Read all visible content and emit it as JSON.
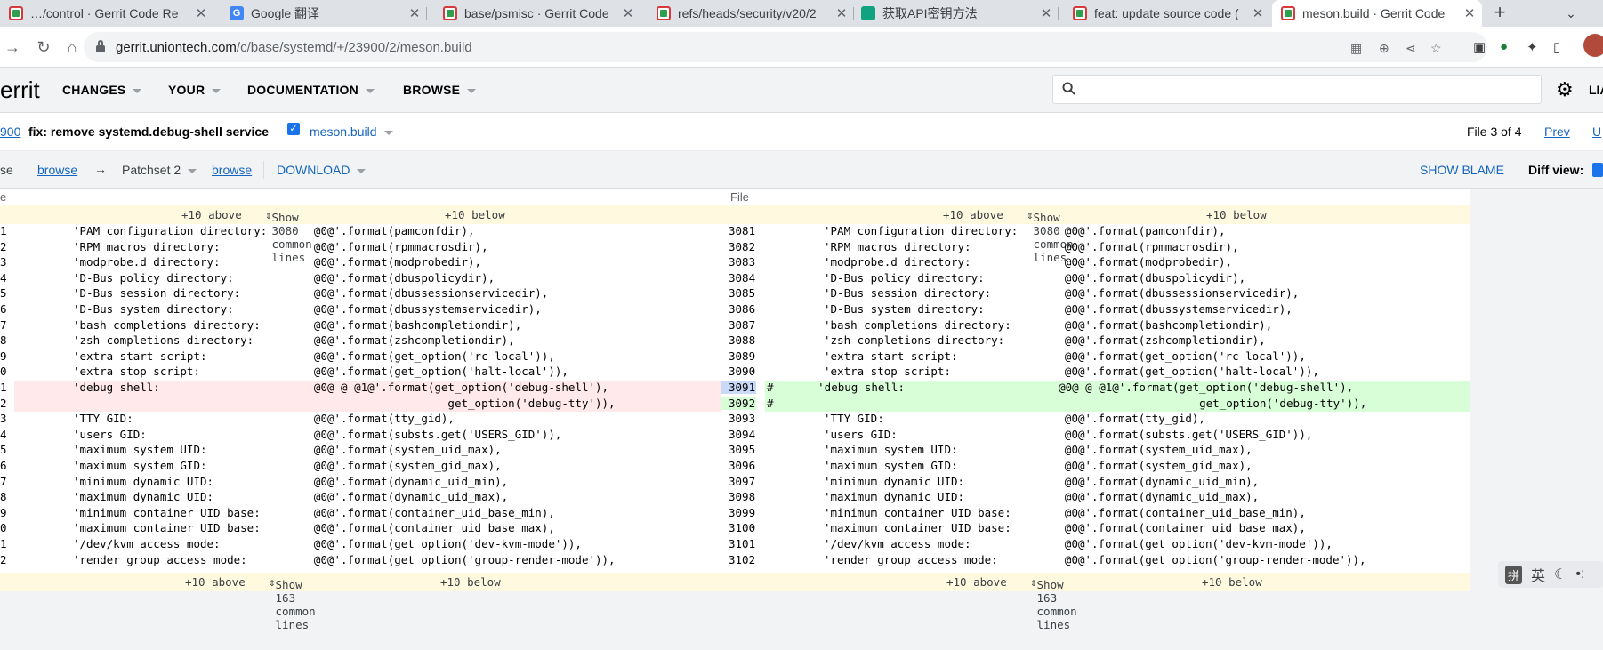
{
  "tabs": [
    {
      "title": "…/control · Gerrit Code Re",
      "favicon": "gerrit-icon"
    },
    {
      "title": "Google 翻译",
      "favicon": "google-translate-icon"
    },
    {
      "title": "base/psmisc · Gerrit Code",
      "favicon": "gerrit-icon"
    },
    {
      "title": "refs/heads/security/v20/2",
      "favicon": "gerrit-icon"
    },
    {
      "title": "获取API密钥方法",
      "favicon": "chatgpt-icon"
    },
    {
      "title": "feat: update source code (",
      "favicon": "gerrit-icon"
    },
    {
      "title": "meson.build · Gerrit Code",
      "favicon": "gerrit-icon",
      "active": true
    }
  ],
  "address": {
    "host": "gerrit.uniontech.com",
    "path": "/c/base/systemd/+/23900/2/meson.build"
  },
  "gerrit": {
    "logo": "errit",
    "nav": [
      "CHANGES",
      "YOUR",
      "DOCUMENTATION",
      "BROWSE"
    ],
    "search_placeholder": "",
    "user_trunc": "LIA"
  },
  "change": {
    "number": "900",
    "subject": "fix: remove systemd.debug-shell service",
    "file": "meson.build",
    "file_of": "File 3 of 4",
    "prev": "Prev",
    "up": "U"
  },
  "patchset": {
    "base_trunc": "se",
    "browse": "browse",
    "arrow": "→",
    "patchset_label": "Patchset 2",
    "download": "DOWNLOAD",
    "show_blame": "SHOW BLAME",
    "diff_view": "Diff view:"
  },
  "diff": {
    "col_left": "e",
    "col_right": "File",
    "skip_top": {
      "above": "+10 above",
      "show": "Show 3080 common lines",
      "below": "+10 below"
    },
    "skip_bottom": {
      "above": "+10 above",
      "show": "Show 163 common lines",
      "below": "+10 below"
    },
    "rows": [
      {
        "l": "1",
        "r": "3081",
        "left": "'PAM configuration directory:       @0@'.format(pamconfdir),",
        "right": "'PAM configuration directory:       @0@'.format(pamconfdir),"
      },
      {
        "l": "2",
        "r": "3082",
        "left": "'RPM macros directory:              @0@'.format(rpmmacrosdir),",
        "right": "'RPM macros directory:              @0@'.format(rpmmacrosdir),"
      },
      {
        "l": "3",
        "r": "3083",
        "left": "'modprobe.d directory:              @0@'.format(modprobedir),",
        "right": "'modprobe.d directory:              @0@'.format(modprobedir),"
      },
      {
        "l": "4",
        "r": "3084",
        "left": "'D-Bus policy directory:            @0@'.format(dbuspolicydir),",
        "right": "'D-Bus policy directory:            @0@'.format(dbuspolicydir),"
      },
      {
        "l": "5",
        "r": "3085",
        "left": "'D-Bus session directory:           @0@'.format(dbussessionservicedir),",
        "right": "'D-Bus session directory:           @0@'.format(dbussessionservicedir),"
      },
      {
        "l": "6",
        "r": "3086",
        "left": "'D-Bus system directory:            @0@'.format(dbussystemservicedir),",
        "right": "'D-Bus system directory:            @0@'.format(dbussystemservicedir),"
      },
      {
        "l": "7",
        "r": "3087",
        "left": "'bash completions directory:        @0@'.format(bashcompletiondir),",
        "right": "'bash completions directory:        @0@'.format(bashcompletiondir),"
      },
      {
        "l": "8",
        "r": "3088",
        "left": "'zsh completions directory:         @0@'.format(zshcompletiondir),",
        "right": "'zsh completions directory:         @0@'.format(zshcompletiondir),"
      },
      {
        "l": "9",
        "r": "3089",
        "left": "'extra start script:                @0@'.format(get_option('rc-local')),",
        "right": "'extra start script:                @0@'.format(get_option('rc-local')),"
      },
      {
        "l": "0",
        "r": "3090",
        "left": "'extra stop script:                 @0@'.format(get_option('halt-local')),",
        "right": "'extra stop script:                 @0@'.format(get_option('halt-local')),"
      },
      {
        "l": "1",
        "r": "3091",
        "left": "'debug shell:                       @0@ @ @1@'.format(get_option('debug-shell'),",
        "right": "      'debug shell:                       @0@ @ @1@'.format(get_option('debug-shell'),",
        "change": true,
        "hash": "#",
        "selected": true
      },
      {
        "l": "2",
        "r": "3092",
        "left": "                                                        get_option('debug-tty')),",
        "right": "                                                               get_option('debug-tty')),",
        "change": true,
        "hash": "#"
      },
      {
        "l": "3",
        "r": "3093",
        "left": "'TTY GID:                           @0@'.format(tty_gid),",
        "right": "'TTY GID:                           @0@'.format(tty_gid),"
      },
      {
        "l": "4",
        "r": "3094",
        "left": "'users GID:                         @0@'.format(substs.get('USERS_GID')),",
        "right": "'users GID:                         @0@'.format(substs.get('USERS_GID')),"
      },
      {
        "l": "5",
        "r": "3095",
        "left": "'maximum system UID:                @0@'.format(system_uid_max),",
        "right": "'maximum system UID:                @0@'.format(system_uid_max),"
      },
      {
        "l": "6",
        "r": "3096",
        "left": "'maximum system GID:                @0@'.format(system_gid_max),",
        "right": "'maximum system GID:                @0@'.format(system_gid_max),"
      },
      {
        "l": "7",
        "r": "3097",
        "left": "'minimum dynamic UID:               @0@'.format(dynamic_uid_min),",
        "right": "'minimum dynamic UID:               @0@'.format(dynamic_uid_min),"
      },
      {
        "l": "8",
        "r": "3098",
        "left": "'maximum dynamic UID:               @0@'.format(dynamic_uid_max),",
        "right": "'maximum dynamic UID:               @0@'.format(dynamic_uid_max),"
      },
      {
        "l": "9",
        "r": "3099",
        "left": "'minimum container UID base:        @0@'.format(container_uid_base_min),",
        "right": "'minimum container UID base:        @0@'.format(container_uid_base_min),"
      },
      {
        "l": "0",
        "r": "3100",
        "left": "'maximum container UID base:        @0@'.format(container_uid_base_max),",
        "right": "'maximum container UID base:        @0@'.format(container_uid_base_max),"
      },
      {
        "l": "1",
        "r": "3101",
        "left": "'/dev/kvm access mode:              @0@'.format(get_option('dev-kvm-mode')),",
        "right": "'/dev/kvm access mode:              @0@'.format(get_option('dev-kvm-mode')),"
      },
      {
        "l": "2",
        "r": "3102",
        "left": "'render group access mode:          @0@'.format(get_option('group-render-mode')),",
        "right": "'render group access mode:          @0@'.format(get_option('group-render-mode')),"
      }
    ]
  },
  "ime": {
    "pin": "拼",
    "lang": "英",
    "moon": "☾",
    "dots": "•:"
  },
  "colors": {
    "accent": "#1565c0",
    "deleted_bg": "#ffe9ea",
    "added_bg": "#d8fed8",
    "skip_bg": "#fff9e0"
  }
}
